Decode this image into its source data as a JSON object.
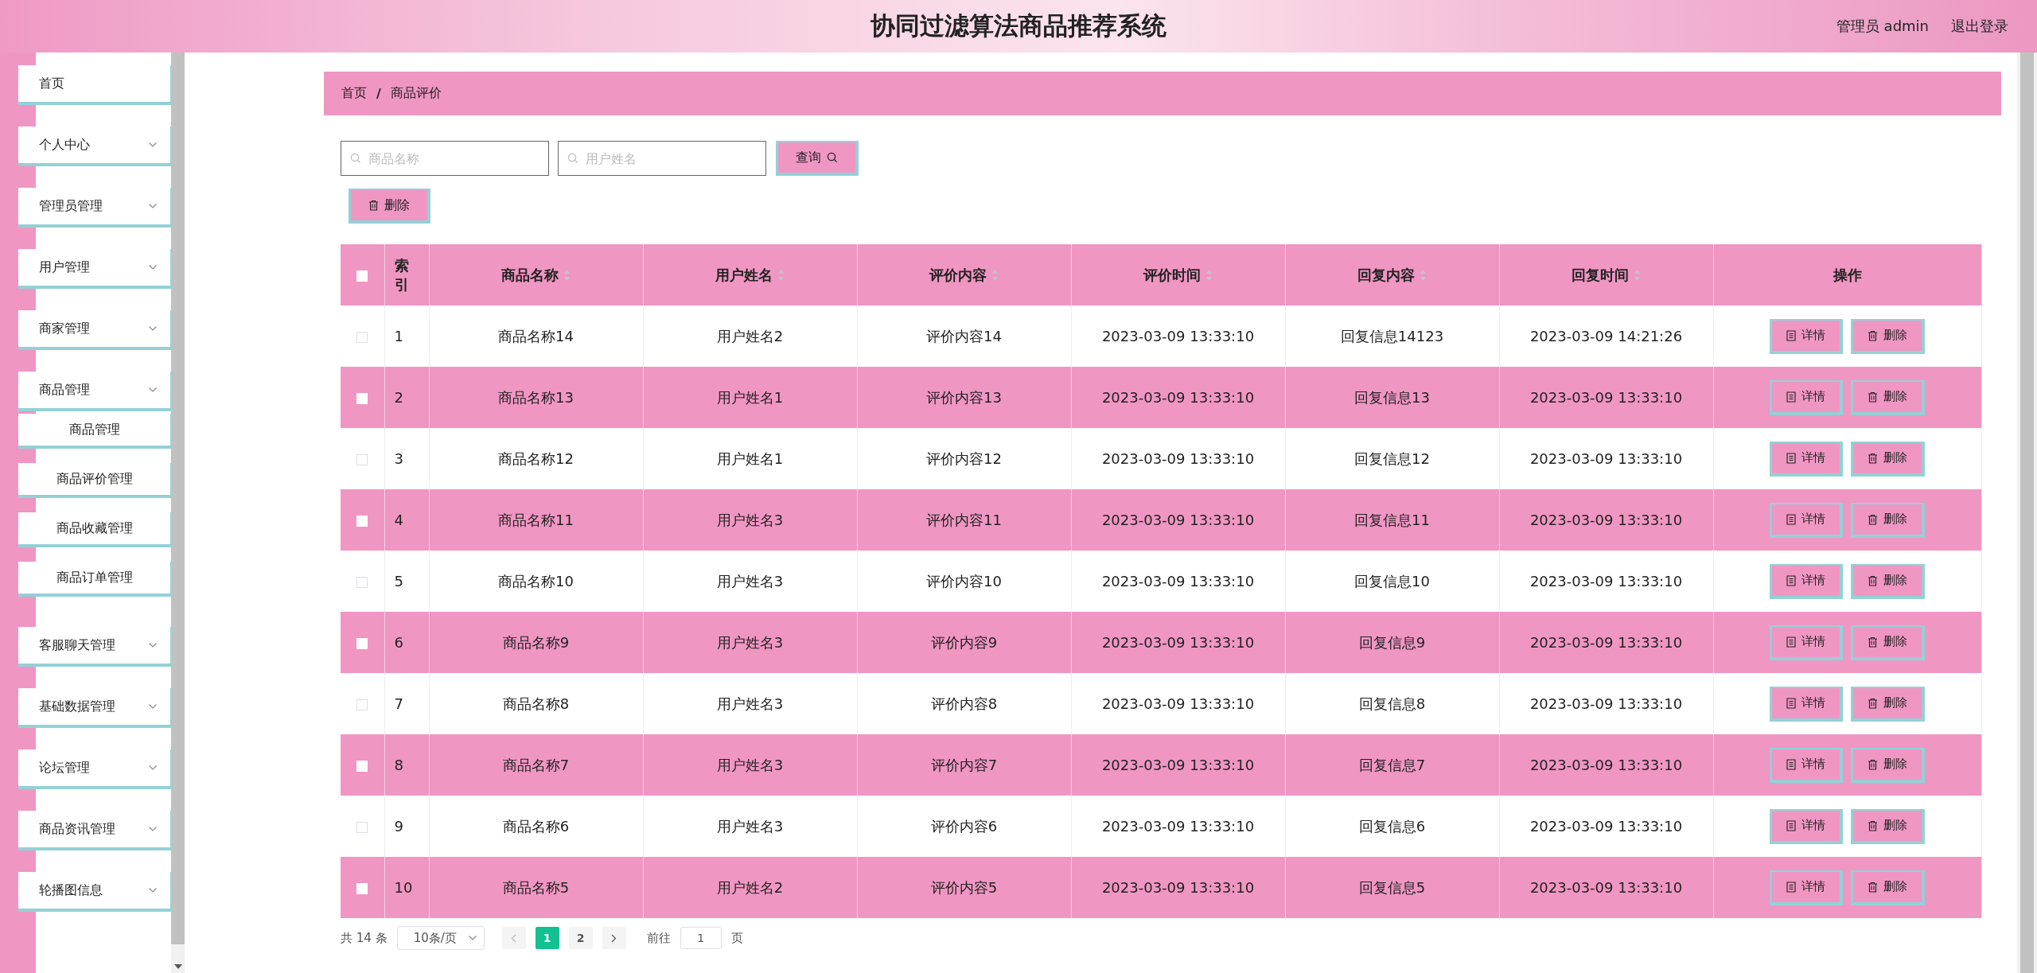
{
  "header": {
    "title": "协同过滤算法商品推荐系统",
    "user": "管理员 admin",
    "logout": "退出登录"
  },
  "sidebar": {
    "items": [
      {
        "label": "首页",
        "kind": "link"
      },
      {
        "label": "个人中心",
        "kind": "group"
      },
      {
        "label": "管理员管理",
        "kind": "group"
      },
      {
        "label": "用户管理",
        "kind": "group"
      },
      {
        "label": "商家管理",
        "kind": "group"
      },
      {
        "label": "商品管理",
        "kind": "group",
        "children": [
          {
            "label": "商品管理"
          },
          {
            "label": "商品评价管理"
          },
          {
            "label": "商品收藏管理"
          },
          {
            "label": "商品订单管理"
          }
        ]
      },
      {
        "label": "客服聊天管理",
        "kind": "group"
      },
      {
        "label": "基础数据管理",
        "kind": "group"
      },
      {
        "label": "论坛管理",
        "kind": "group"
      },
      {
        "label": "商品资讯管理",
        "kind": "group"
      },
      {
        "label": "轮播图信息",
        "kind": "group"
      }
    ]
  },
  "breadcrumb": {
    "items": [
      "首页",
      "商品评价"
    ],
    "separator": "/"
  },
  "search": {
    "fields": [
      {
        "placeholder": "商品名称"
      },
      {
        "placeholder": "用户姓名"
      }
    ],
    "button": "查询"
  },
  "toolbar": {
    "delete_button": "删除"
  },
  "table": {
    "header_checked": false,
    "columns": [
      {
        "label": "索引",
        "kind": "plain"
      },
      {
        "label": "商品名称",
        "kind": "sortable"
      },
      {
        "label": "用户姓名",
        "kind": "sortable"
      },
      {
        "label": "评价内容",
        "kind": "sortable"
      },
      {
        "label": "评价时间",
        "kind": "sortable"
      },
      {
        "label": "回复内容",
        "kind": "sortable"
      },
      {
        "label": "回复时间",
        "kind": "sortable"
      },
      {
        "label": "操作",
        "kind": "plain"
      }
    ],
    "rows": [
      {
        "checked": false,
        "cells": [
          "1",
          "商品名称14",
          "用户姓名2",
          "评价内容14",
          "2023-03-09 13:33:10",
          "回复信息14123",
          "2023-03-09 14:21:26"
        ],
        "actions": [
          "详情",
          "删除"
        ]
      },
      {
        "checked": false,
        "cells": [
          "2",
          "商品名称13",
          "用户姓名1",
          "评价内容13",
          "2023-03-09 13:33:10",
          "回复信息13",
          "2023-03-09 13:33:10"
        ],
        "actions": [
          "详情",
          "删除"
        ]
      },
      {
        "checked": false,
        "cells": [
          "3",
          "商品名称12",
          "用户姓名1",
          "评价内容12",
          "2023-03-09 13:33:10",
          "回复信息12",
          "2023-03-09 13:33:10"
        ],
        "actions": [
          "详情",
          "删除"
        ]
      },
      {
        "checked": false,
        "cells": [
          "4",
          "商品名称11",
          "用户姓名3",
          "评价内容11",
          "2023-03-09 13:33:10",
          "回复信息11",
          "2023-03-09 13:33:10"
        ],
        "actions": [
          "详情",
          "删除"
        ]
      },
      {
        "checked": false,
        "cells": [
          "5",
          "商品名称10",
          "用户姓名3",
          "评价内容10",
          "2023-03-09 13:33:10",
          "回复信息10",
          "2023-03-09 13:33:10"
        ],
        "actions": [
          "详情",
          "删除"
        ]
      },
      {
        "checked": false,
        "cells": [
          "6",
          "商品名称9",
          "用户姓名3",
          "评价内容9",
          "2023-03-09 13:33:10",
          "回复信息9",
          "2023-03-09 13:33:10"
        ],
        "actions": [
          "详情",
          "删除"
        ]
      },
      {
        "checked": false,
        "cells": [
          "7",
          "商品名称8",
          "用户姓名3",
          "评价内容8",
          "2023-03-09 13:33:10",
          "回复信息8",
          "2023-03-09 13:33:10"
        ],
        "actions": [
          "详情",
          "删除"
        ]
      },
      {
        "checked": false,
        "cells": [
          "8",
          "商品名称7",
          "用户姓名3",
          "评价内容7",
          "2023-03-09 13:33:10",
          "回复信息7",
          "2023-03-09 13:33:10"
        ],
        "actions": [
          "详情",
          "删除"
        ]
      },
      {
        "checked": false,
        "cells": [
          "9",
          "商品名称6",
          "用户姓名3",
          "评价内容6",
          "2023-03-09 13:33:10",
          "回复信息6",
          "2023-03-09 13:33:10"
        ],
        "actions": [
          "详情",
          "删除"
        ]
      },
      {
        "checked": false,
        "cells": [
          "10",
          "商品名称5",
          "用户姓名2",
          "评价内容5",
          "2023-03-09 13:33:10",
          "回复信息5",
          "2023-03-09 13:33:10"
        ],
        "actions": [
          "详情",
          "删除"
        ]
      }
    ]
  },
  "pagination": {
    "total": "共 14 条",
    "page_size": "10条/页",
    "pages": [
      {
        "label": "1",
        "selected": true
      },
      {
        "label": "2",
        "selected": false
      }
    ],
    "goto_label": "前往",
    "goto_value": "1",
    "goto_suffix": "页"
  }
}
